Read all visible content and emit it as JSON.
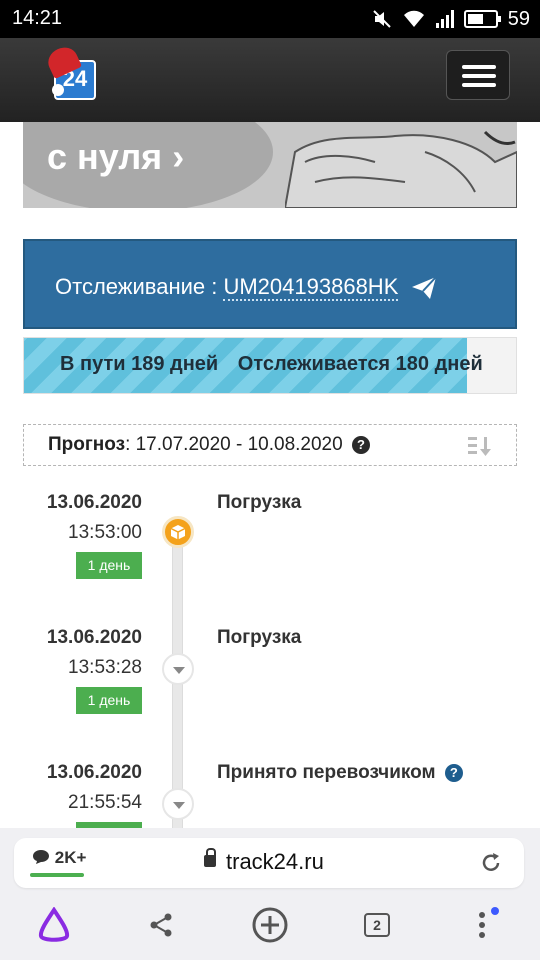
{
  "status_bar": {
    "time": "14:21",
    "battery": "59",
    "battery_level": 0.59,
    "icons": [
      "mute-icon",
      "wifi-icon",
      "signal-icon",
      "battery-icon"
    ]
  },
  "site": {
    "logo_text": "24",
    "logo_icon": "santa-hat-icon",
    "menu_icon": "hamburger-icon"
  },
  "hero": {
    "text": "с нуля ›"
  },
  "tracking": {
    "label": "Отслеживание : ",
    "number": "UM204193868HK",
    "send_icon": "paper-plane-icon"
  },
  "progress": {
    "in_transit": "В пути 189 дней",
    "tracked": "Отслеживается 180 дней",
    "fill_fraction": 0.9,
    "color": "#5fc0dc"
  },
  "forecast": {
    "label": "Прогноз",
    "value": ": 17.07.2020 - 10.08.2020",
    "help_icon": "question-icon",
    "sort_icon": "sort-down-icon"
  },
  "events": [
    {
      "date": "13.06.2020",
      "time": "13:53:00",
      "duration": "1 день",
      "title": "Погрузка"
    },
    {
      "date": "13.06.2020",
      "time": "13:53:28",
      "duration": "1 день",
      "title": "Погрузка"
    },
    {
      "date": "13.06.2020",
      "time": "21:55:54",
      "duration": "",
      "title": "Принято перевозчиком"
    }
  ],
  "browser": {
    "comments": "2K+",
    "url": "track24.ru",
    "tabs_count": "2",
    "nav_icons": [
      "alice-icon",
      "share-icon",
      "new-tab-icon",
      "tabs-icon",
      "more-menu-icon"
    ]
  },
  "colors": {
    "tracking_bg": "#2e6d9f",
    "badge_green": "#4cae4f",
    "node_orange": "#f4a21b"
  }
}
